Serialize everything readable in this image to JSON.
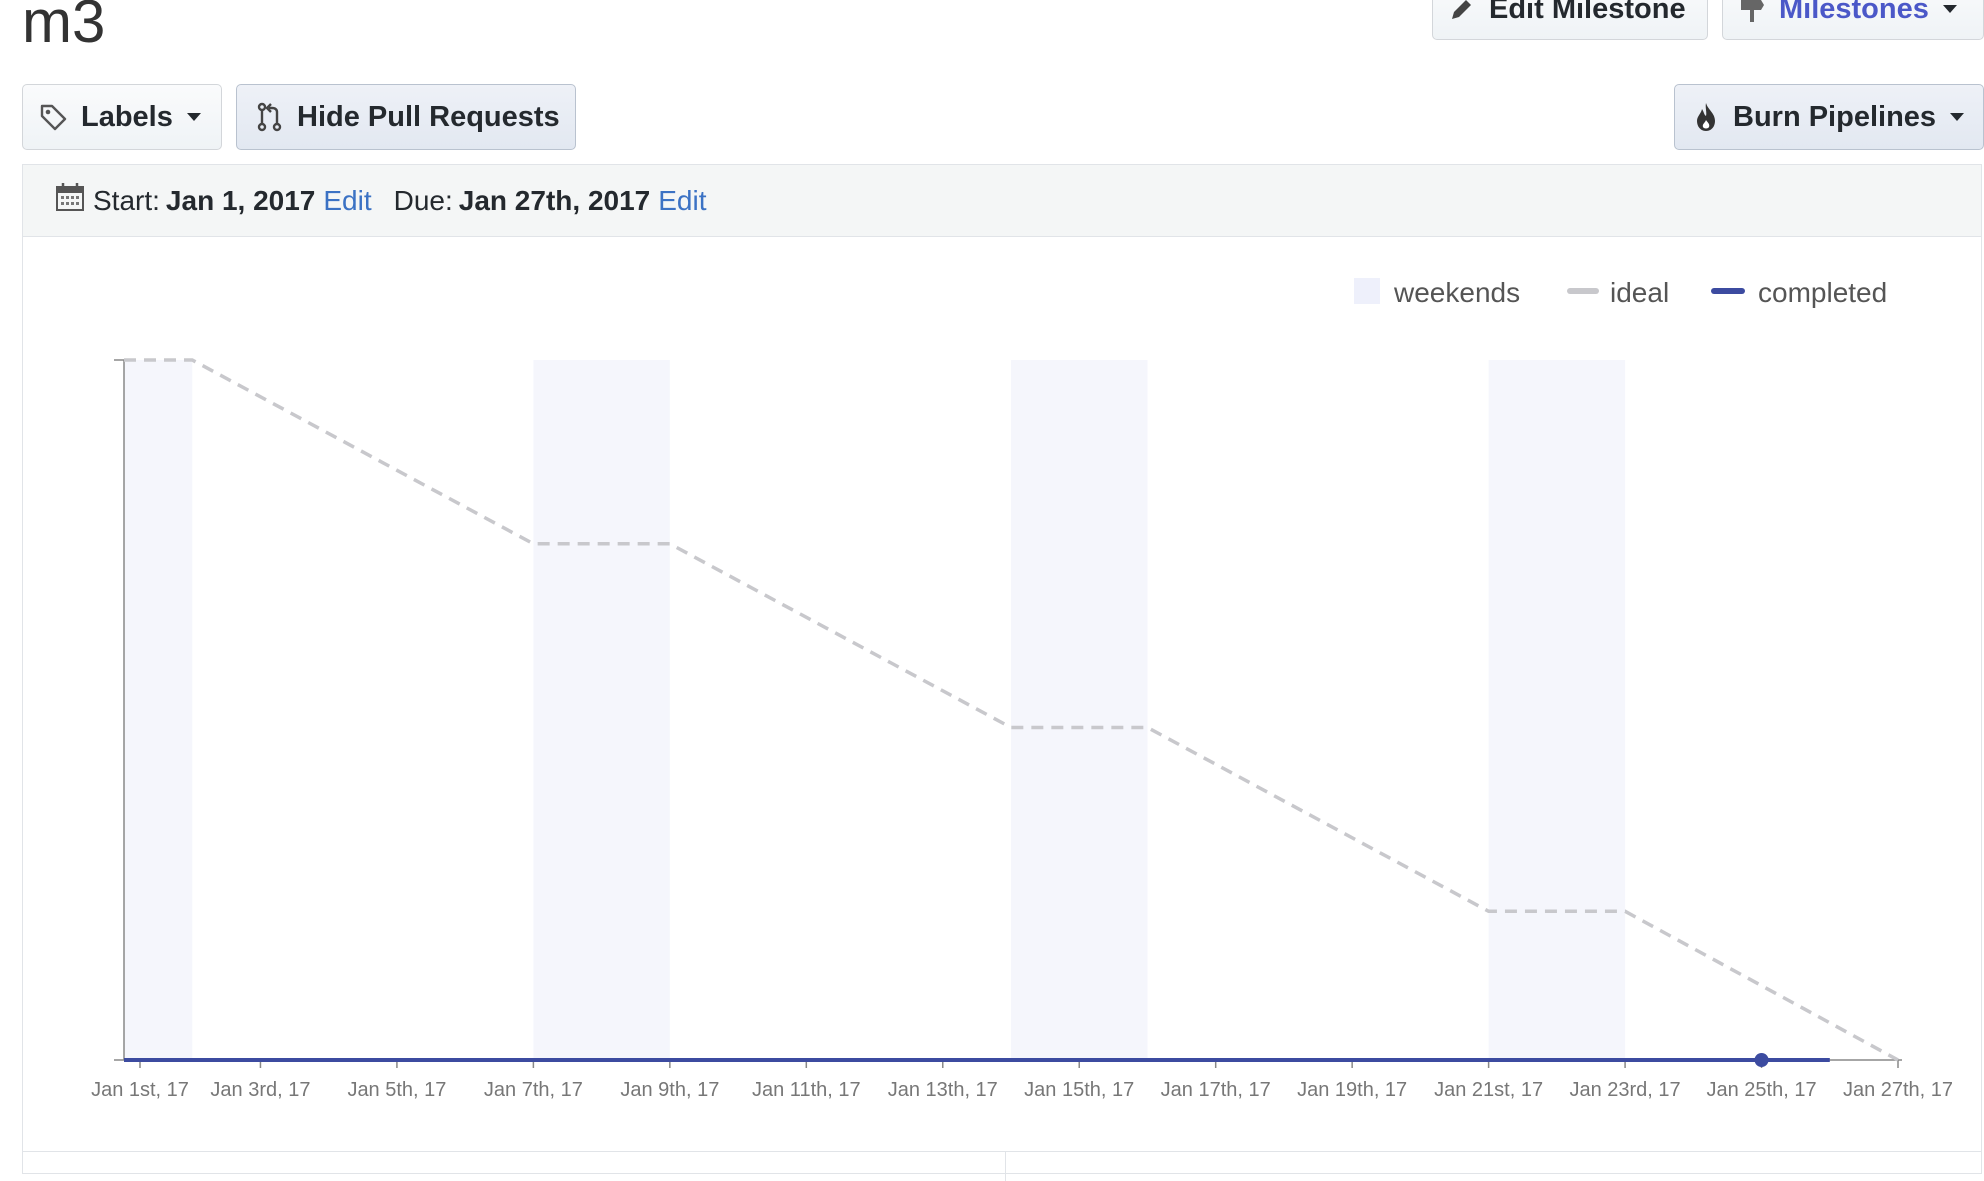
{
  "page": {
    "title": "m3"
  },
  "header_buttons": {
    "edit_milestone": "Edit Milestone",
    "milestones": "Milestones"
  },
  "toolbar": {
    "labels": "Labels",
    "hide_pull_requests": "Hide Pull Requests",
    "burn_pipelines": "Burn Pipelines"
  },
  "dates": {
    "start_label": "Start:",
    "start_value": "Jan 1, 2017",
    "start_edit": "Edit",
    "due_label": "Due:",
    "due_value": "Jan 27th, 2017",
    "due_edit": "Edit"
  },
  "colors": {
    "accent": "#4b58c8",
    "link": "#3b72c4",
    "completed": "#3c4ba0",
    "ideal": "#c8c8cc",
    "weekend": "#f5f6fc"
  },
  "icons": {
    "edit": "pencil-icon",
    "milestones": "milestone-icon",
    "labels": "tag-icon",
    "pull_requests": "git-pull-request-icon",
    "burn": "flame-icon",
    "calendar": "calendar-icon"
  },
  "chart_data": {
    "type": "line",
    "legend": [
      "weekends",
      "ideal",
      "completed"
    ],
    "legend_position": "top-right",
    "x_tick_labels": [
      "Jan 1st, 17",
      "Jan 3rd, 17",
      "Jan 5th, 17",
      "Jan 7th, 17",
      "Jan 9th, 17",
      "Jan 11th, 17",
      "Jan 13th, 17",
      "Jan 15th, 17",
      "Jan 17th, 17",
      "Jan 19th, 17",
      "Jan 21st, 17",
      "Jan 23rd, 17",
      "Jan 25th, 17",
      "Jan 27th, 17"
    ],
    "x_range": [
      "2017-01-01",
      "2017-01-27"
    ],
    "y_range": [
      0,
      1
    ],
    "weekends": [
      [
        "2017-01-01",
        "2017-01-01"
      ],
      [
        "2017-01-07",
        "2017-01-08"
      ],
      [
        "2017-01-14",
        "2017-01-15"
      ],
      [
        "2017-01-21",
        "2017-01-22"
      ]
    ],
    "series": [
      {
        "name": "ideal",
        "style": "dashed",
        "x": [
          "2017-01-01",
          "2017-01-02",
          "2017-01-07",
          "2017-01-09",
          "2017-01-14",
          "2017-01-16",
          "2017-01-21",
          "2017-01-23",
          "2017-01-27"
        ],
        "y": [
          1.0,
          1.0,
          0.7375,
          0.7375,
          0.475,
          0.475,
          0.2125,
          0.2125,
          0.0
        ]
      },
      {
        "name": "completed",
        "style": "solid",
        "x": [
          "2017-01-01",
          "2017-01-25",
          "2017-01-26"
        ],
        "y": [
          0,
          0,
          0
        ],
        "marker_at": "2017-01-25"
      }
    ]
  }
}
